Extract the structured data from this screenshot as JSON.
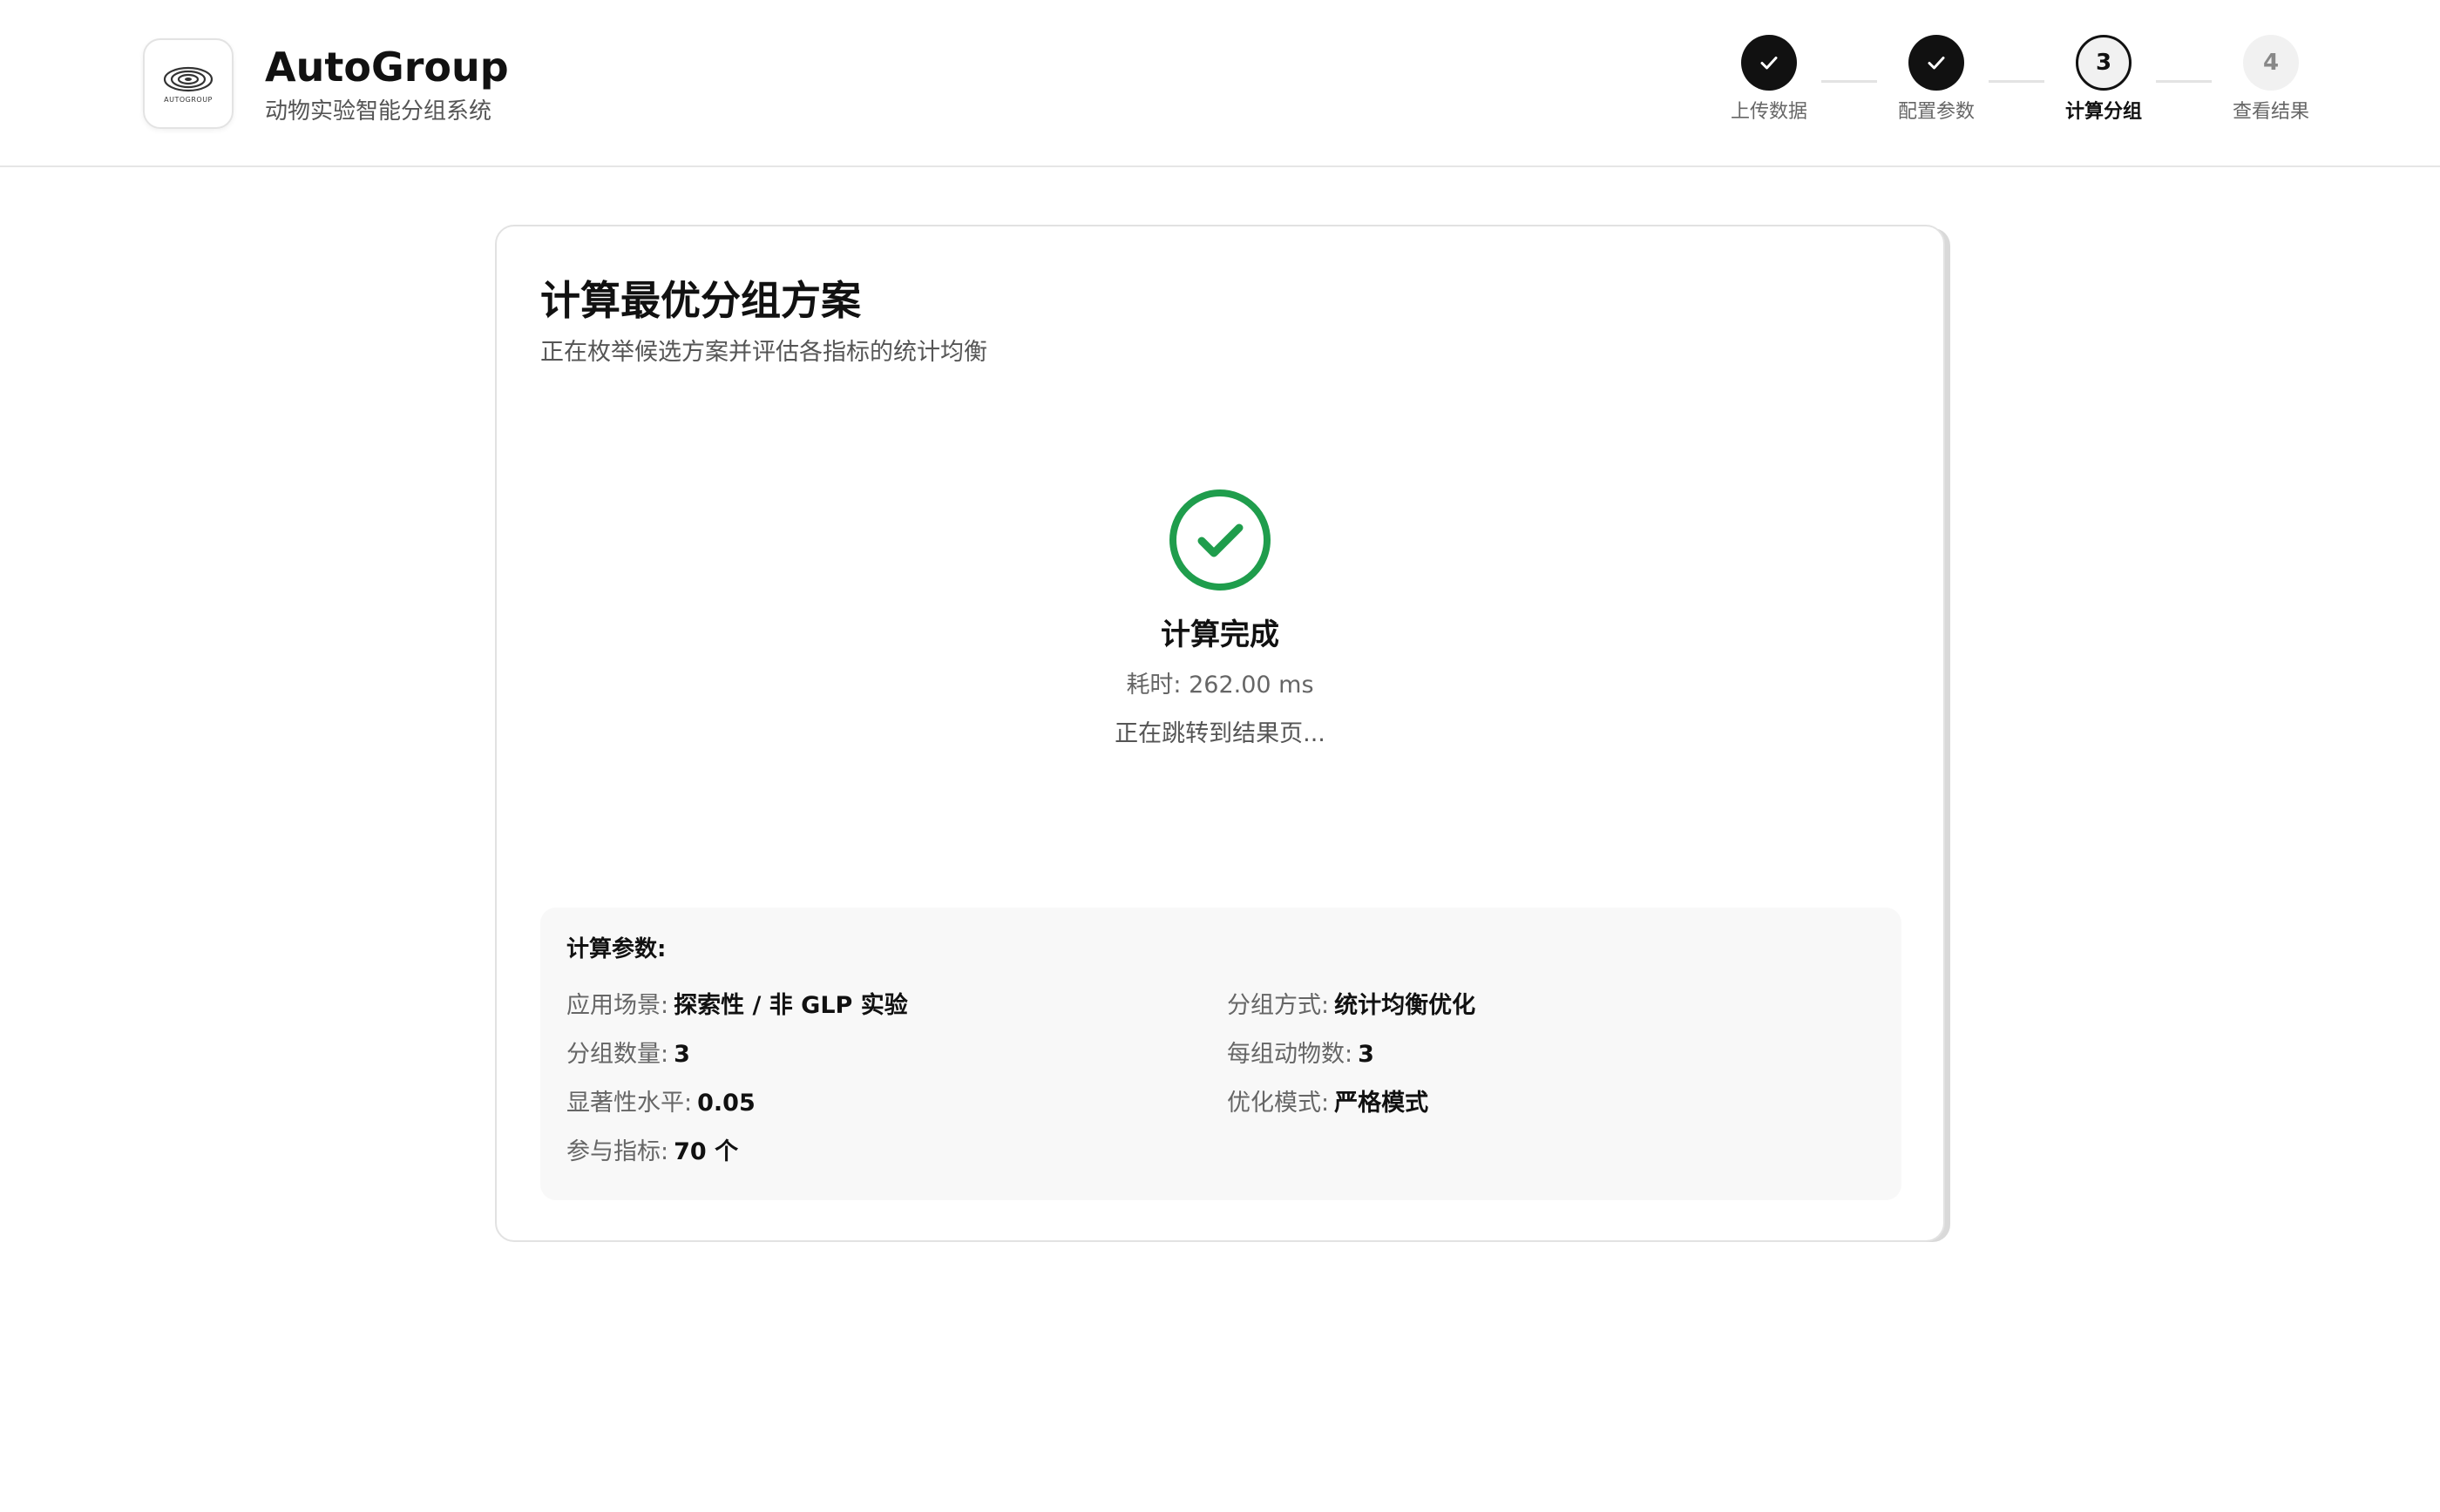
{
  "header": {
    "logo_text": "AUTOGROUP",
    "brand_name": "AutoGroup",
    "brand_subtitle": "动物实验智能分组系统"
  },
  "stepper": {
    "steps": [
      {
        "number": "1",
        "label": "上传数据",
        "state": "done"
      },
      {
        "number": "2",
        "label": "配置参数",
        "state": "done"
      },
      {
        "number": "3",
        "label": "计算分组",
        "state": "active"
      },
      {
        "number": "4",
        "label": "查看结果",
        "state": "todo"
      }
    ]
  },
  "card": {
    "title": "计算最优分组方案",
    "subtitle": "正在枚举候选方案并评估各指标的统计均衡"
  },
  "status": {
    "icon": "check-circle-icon",
    "title": "计算完成",
    "elapsed": "耗时: 262.00 ms",
    "redirect": "正在跳转到结果页..."
  },
  "params": {
    "title": "计算参数:",
    "items": [
      {
        "key": "应用场景:",
        "value": "探索性 / 非 GLP 实验"
      },
      {
        "key": "分组方式:",
        "value": "统计均衡优化"
      },
      {
        "key": "分组数量:",
        "value": "3"
      },
      {
        "key": "每组动物数:",
        "value": "3"
      },
      {
        "key": "显著性水平:",
        "value": "0.05"
      },
      {
        "key": "优化模式:",
        "value": "严格模式"
      },
      {
        "key": "参与指标:",
        "value": "70 个"
      }
    ]
  },
  "colors": {
    "accent_dark": "#111111",
    "success_green": "#1f9d4c",
    "panel_bg": "#f8f8f8"
  }
}
